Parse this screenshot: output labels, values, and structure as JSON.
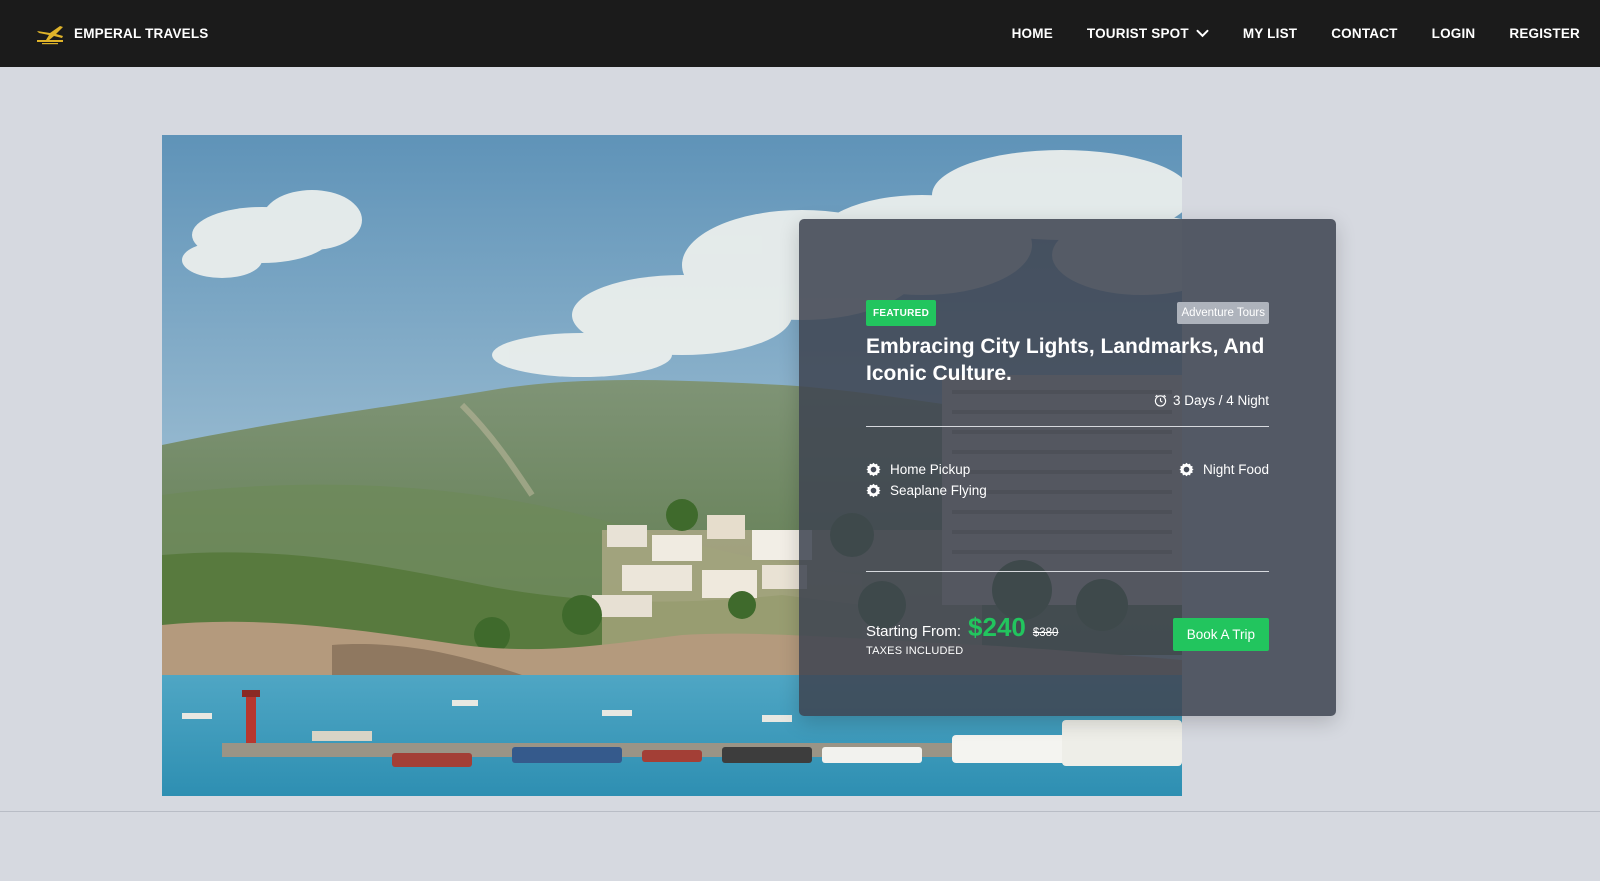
{
  "brand": {
    "name": "EMPERAL TRAVELS",
    "logo_icon": "plane-logo-icon",
    "logo_color": "#e0b42a"
  },
  "nav": {
    "items": [
      {
        "label": "HOME"
      },
      {
        "label": "TOURIST SPOT",
        "has_dropdown": true
      },
      {
        "label": "MY LIST"
      },
      {
        "label": "CONTACT"
      },
      {
        "label": "LOGIN"
      },
      {
        "label": "REGISTER"
      }
    ]
  },
  "card": {
    "badge": "FEATURED",
    "category": "Adventure Tours",
    "title": "Embracing City Lights, Landmarks, And Iconic Culture.",
    "duration": "3 Days / 4 Night",
    "features_left": [
      "Home Pickup",
      "Seaplane Flying"
    ],
    "features_right": [
      "Night Food"
    ],
    "starting_label": "Starting From:",
    "price": "$240",
    "old_price": "$380",
    "taxes": "TAXES INCLUDED",
    "button": "Book A Trip"
  },
  "colors": {
    "accent": "#22c55e",
    "navbar_bg": "#1b1b1b",
    "page_bg": "#d6d9e0",
    "card_bg": "#3e4450"
  }
}
